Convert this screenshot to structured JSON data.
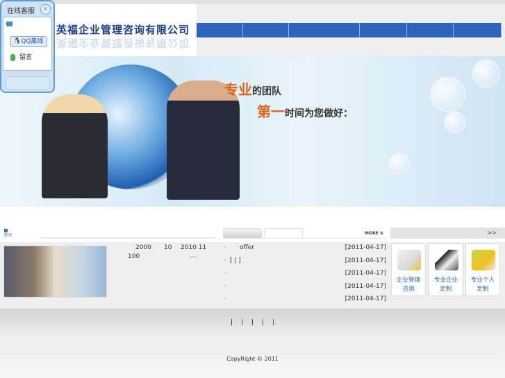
{
  "company_name": "英福企业管理咨询有限公司",
  "nav": {
    "items": [
      "",
      "",
      "",
      "",
      "",
      ""
    ]
  },
  "banner": {
    "slogan1_highlight": "专业",
    "slogan1_rest": "的团队",
    "slogan2_highlight": "第一",
    "slogan2_rest": "时间为您做好："
  },
  "support": {
    "title": "在线客服",
    "close": "x",
    "qq": "QQ离线",
    "message": "留言"
  },
  "news": {
    "more": "MORE ⊕",
    "items": [
      {
        "title": "offer",
        "date": "[2011-04-17]"
      },
      {
        "title": "[ | ]",
        "date": "[2011-04-17]"
      },
      {
        "title": "",
        "date": "[2011-04-17]"
      },
      {
        "title": "",
        "date": "[2011-04-17]"
      },
      {
        "title": "",
        "date": "[2011-04-17]"
      }
    ]
  },
  "intro": {
    "t1": "2000",
    "t2": "10",
    "t3": "2010 11",
    "t4": "100",
    "t5": "..."
  },
  "services": {
    "more": ">>",
    "items": [
      {
        "line1": "企业管理",
        "line2": "咨询"
      },
      {
        "line1": "专业企业",
        "line2": "定制"
      },
      {
        "line1": "专业个人",
        "line2": "定制"
      }
    ]
  },
  "footer": {
    "links": [
      "|",
      "|",
      "|",
      "|",
      "|"
    ],
    "copyright": "CopyRight © 2011"
  }
}
